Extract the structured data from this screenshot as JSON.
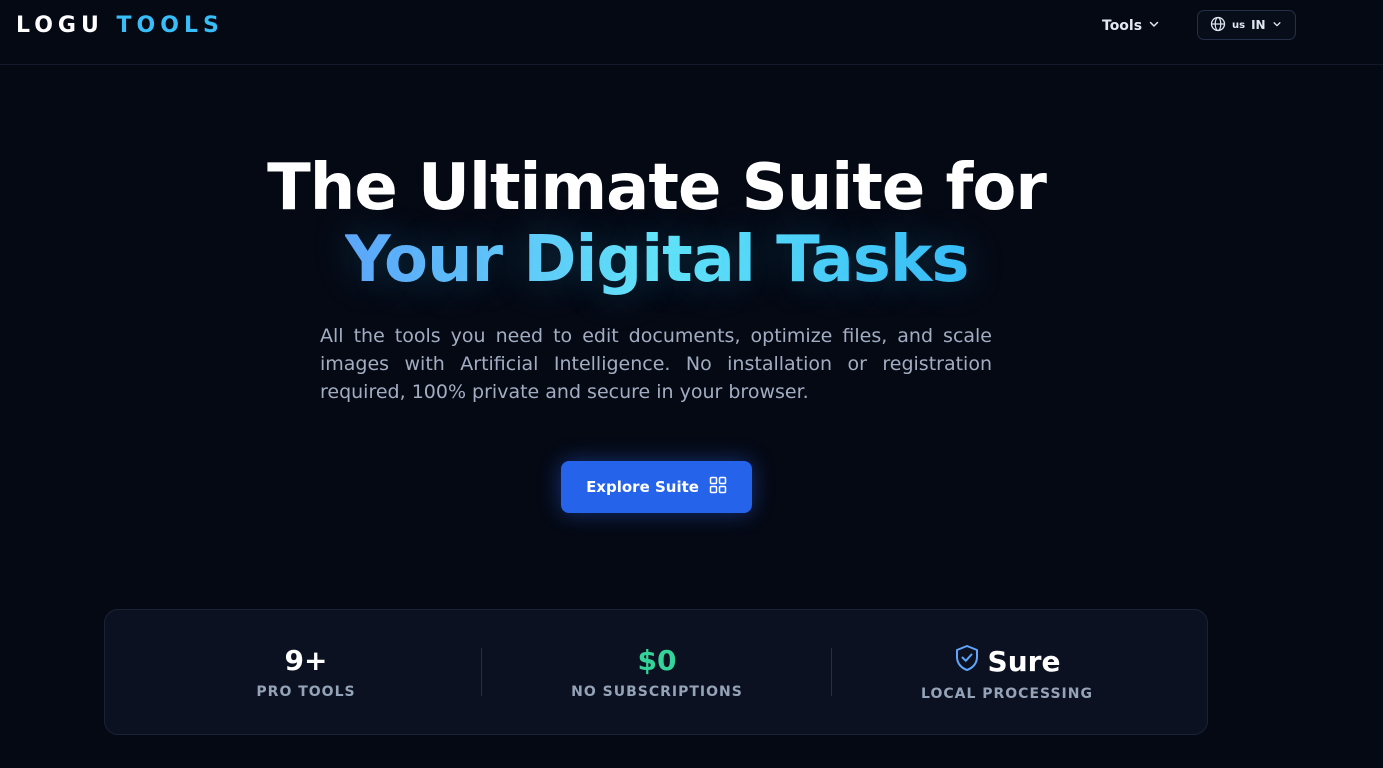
{
  "brand": {
    "part1": "LOGU",
    "part2": "TOOLS"
  },
  "nav": {
    "tools_label": "Tools"
  },
  "language": {
    "flag": "us",
    "code": "IN"
  },
  "hero": {
    "title_line1": "The Ultimate Suite for",
    "title_line2": "Your Digital Tasks",
    "description": "All the tools you need to edit documents, optimize files, and scale images with Artificial Intelligence. No installation or registration required, 100% private and secure in your browser.",
    "cta_label": "Explore Suite"
  },
  "stats": [
    {
      "value": "9+",
      "label": "PRO TOOLS"
    },
    {
      "value": "$0",
      "label": "NO SUBSCRIPTIONS"
    },
    {
      "value": "Sure",
      "label": "LOCAL PROCESSING",
      "icon": "shield-check-icon"
    }
  ],
  "colors": {
    "background": "#050914",
    "accent_blue": "#2563eb",
    "accent_cyan": "#38bdf8",
    "green": "#34d399"
  }
}
